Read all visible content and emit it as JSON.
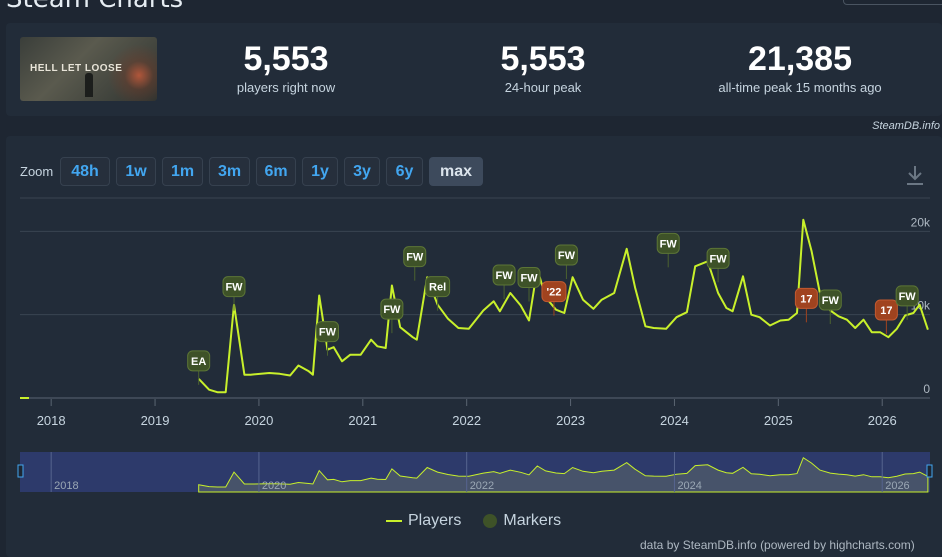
{
  "page": {
    "title": "Steam Charts"
  },
  "game": {
    "name": "HELL LET LOOSE"
  },
  "stats": [
    {
      "value": "5,553",
      "label": "players right now"
    },
    {
      "value": "5,553",
      "label": "24-hour peak"
    },
    {
      "value": "21,385",
      "label": "all-time peak 15 months ago"
    }
  ],
  "credit_top": "SteamDB.info",
  "zoom": {
    "label": "Zoom",
    "buttons": [
      "48h",
      "1w",
      "1m",
      "3m",
      "6m",
      "1y",
      "3y",
      "6y",
      "max"
    ],
    "active": "max"
  },
  "legend": {
    "players": "Players",
    "markers": "Markers"
  },
  "credit_bottom": "data by SteamDB.info (powered by highcharts.com)",
  "colors": {
    "series": "#c8f02b",
    "marker": "#3e5228",
    "marker_alt": "#a0431f",
    "accent": "#42a6f0"
  },
  "chart_data": {
    "type": "line",
    "series": [
      {
        "name": "Players",
        "points": [
          [
            2017.7,
            0
          ],
          [
            2019.42,
            2300
          ],
          [
            2019.52,
            1000
          ],
          [
            2019.6,
            700
          ],
          [
            2019.68,
            700
          ],
          [
            2019.76,
            11200
          ],
          [
            2019.86,
            2800
          ],
          [
            2019.92,
            2800
          ],
          [
            2020.1,
            3000
          ],
          [
            2020.2,
            2900
          ],
          [
            2020.3,
            2700
          ],
          [
            2020.38,
            3900
          ],
          [
            2020.48,
            3200
          ],
          [
            2020.52,
            2800
          ],
          [
            2020.58,
            12300
          ],
          [
            2020.66,
            5800
          ],
          [
            2020.72,
            6100
          ],
          [
            2020.8,
            4400
          ],
          [
            2020.88,
            5200
          ],
          [
            2020.98,
            5200
          ],
          [
            2021.08,
            7000
          ],
          [
            2021.14,
            6200
          ],
          [
            2021.22,
            6000
          ],
          [
            2021.28,
            13500
          ],
          [
            2021.36,
            8500
          ],
          [
            2021.48,
            7300
          ],
          [
            2021.52,
            7000
          ],
          [
            2021.62,
            14500
          ],
          [
            2021.72,
            11200
          ],
          [
            2021.82,
            9500
          ],
          [
            2021.92,
            8400
          ],
          [
            2022.02,
            8300
          ],
          [
            2022.16,
            10500
          ],
          [
            2022.26,
            11600
          ],
          [
            2022.32,
            10400
          ],
          [
            2022.42,
            12600
          ],
          [
            2022.52,
            11100
          ],
          [
            2022.6,
            9300
          ],
          [
            2022.68,
            15500
          ],
          [
            2022.76,
            12100
          ],
          [
            2022.86,
            10600
          ],
          [
            2022.94,
            10200
          ],
          [
            2023.02,
            14500
          ],
          [
            2023.12,
            11800
          ],
          [
            2023.22,
            10700
          ],
          [
            2023.3,
            11800
          ],
          [
            2023.42,
            12600
          ],
          [
            2023.54,
            17900
          ],
          [
            2023.62,
            13300
          ],
          [
            2023.72,
            8600
          ],
          [
            2023.8,
            8400
          ],
          [
            2023.92,
            8300
          ],
          [
            2024.02,
            9700
          ],
          [
            2024.12,
            10300
          ],
          [
            2024.2,
            15800
          ],
          [
            2024.32,
            16400
          ],
          [
            2024.42,
            12600
          ],
          [
            2024.5,
            10800
          ],
          [
            2024.56,
            10400
          ],
          [
            2024.66,
            14600
          ],
          [
            2024.74,
            10000
          ],
          [
            2024.82,
            9700
          ],
          [
            2024.92,
            8700
          ],
          [
            2025.02,
            9300
          ],
          [
            2025.1,
            9400
          ],
          [
            2025.18,
            10200
          ],
          [
            2025.24,
            21400
          ],
          [
            2025.32,
            17600
          ],
          [
            2025.4,
            12600
          ],
          [
            2025.5,
            10500
          ],
          [
            2025.58,
            9800
          ],
          [
            2025.66,
            9400
          ],
          [
            2025.74,
            8400
          ],
          [
            2025.82,
            9400
          ],
          [
            2025.9,
            7900
          ],
          [
            2025.98,
            7900
          ],
          [
            2026.06,
            7300
          ],
          [
            2026.14,
            8300
          ],
          [
            2026.22,
            9900
          ],
          [
            2026.3,
            10200
          ],
          [
            2026.36,
            11200
          ],
          [
            2026.44,
            8200
          ]
        ]
      }
    ],
    "markers": [
      {
        "label": "EA",
        "x": 2019.42,
        "y": 2300,
        "kind": "normal"
      },
      {
        "label": "FW",
        "x": 2019.76,
        "y": 11200,
        "kind": "normal"
      },
      {
        "label": "FW",
        "x": 2020.66,
        "y": 5800,
        "kind": "normal"
      },
      {
        "label": "FW",
        "x": 2021.28,
        "y": 8500,
        "kind": "normal"
      },
      {
        "label": "FW",
        "x": 2021.5,
        "y": 14800,
        "kind": "normal"
      },
      {
        "label": "Rel",
        "x": 2021.72,
        "y": 11200,
        "kind": "normal"
      },
      {
        "label": "FW",
        "x": 2022.36,
        "y": 12600,
        "kind": "normal"
      },
      {
        "label": "FW",
        "x": 2022.6,
        "y": 12300,
        "kind": "normal"
      },
      {
        "label": "'22",
        "x": 2022.84,
        "y": 10600,
        "kind": "alt"
      },
      {
        "label": "FW",
        "x": 2022.96,
        "y": 15000,
        "kind": "normal"
      },
      {
        "label": "FW",
        "x": 2023.94,
        "y": 16400,
        "kind": "normal"
      },
      {
        "label": "FW",
        "x": 2024.42,
        "y": 14600,
        "kind": "normal"
      },
      {
        "label": "17",
        "x": 2025.27,
        "y": 9800,
        "kind": "alt"
      },
      {
        "label": "FW",
        "x": 2025.5,
        "y": 9600,
        "kind": "normal"
      },
      {
        "label": "17",
        "x": 2026.04,
        "y": 8400,
        "kind": "alt"
      },
      {
        "label": "FW",
        "x": 2026.24,
        "y": 10100,
        "kind": "normal"
      }
    ],
    "x_ticks": [
      "2018",
      "2019",
      "2020",
      "2021",
      "2022",
      "2023",
      "2024",
      "2025",
      "2026"
    ],
    "y_ticks": [
      "0",
      "10k",
      "20k"
    ],
    "navigator_ticks": [
      "2018",
      "2020",
      "2022",
      "2024",
      "2026"
    ],
    "xlim": [
      2017.7,
      2026.46
    ],
    "ylim": [
      0,
      24000
    ],
    "grid": true,
    "legend_position": "bottom-center"
  }
}
